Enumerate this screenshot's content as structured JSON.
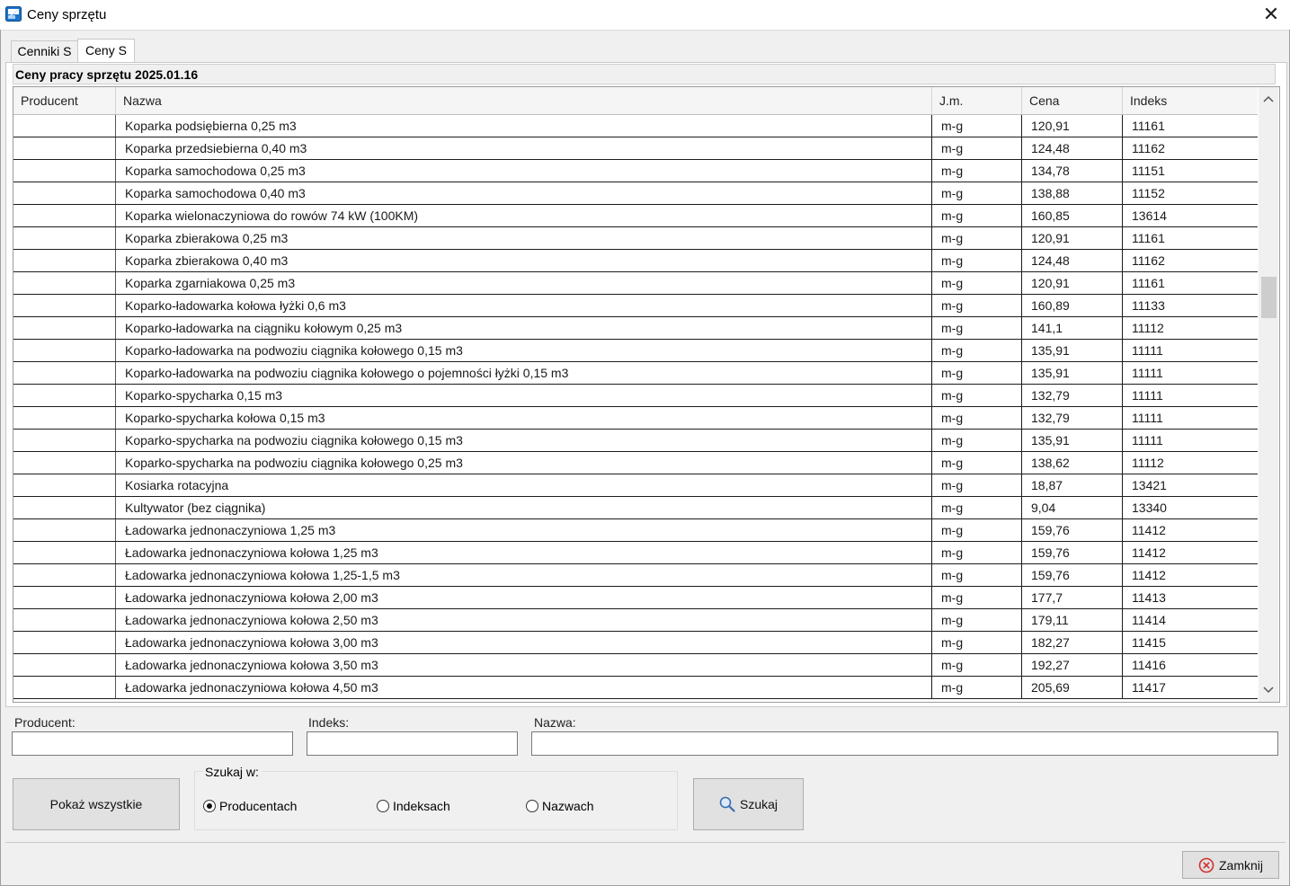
{
  "window": {
    "title": "Ceny sprzętu",
    "close_glyph": "✕"
  },
  "tabs": [
    {
      "label": "Cenniki S"
    },
    {
      "label": "Ceny S"
    }
  ],
  "caption": "Ceny pracy sprzętu 2025.01.16",
  "table": {
    "columns": [
      "Producent",
      "Nazwa",
      "J.m.",
      "Cena",
      "Indeks"
    ],
    "rows": [
      {
        "producent": "",
        "nazwa": "Koparka podsiębierna 0,25 m3",
        "jm": "m-g",
        "cena": "120,91",
        "indeks": "11161"
      },
      {
        "producent": "",
        "nazwa": "Koparka przedsiebierna 0,40 m3",
        "jm": "m-g",
        "cena": "124,48",
        "indeks": "11162"
      },
      {
        "producent": "",
        "nazwa": "Koparka samochodowa 0,25 m3",
        "jm": "m-g",
        "cena": "134,78",
        "indeks": "11151"
      },
      {
        "producent": "",
        "nazwa": "Koparka samochodowa 0,40 m3",
        "jm": "m-g",
        "cena": "138,88",
        "indeks": "11152"
      },
      {
        "producent": "",
        "nazwa": "Koparka wielonaczyniowa do rowów 74 kW (100KM)",
        "jm": "m-g",
        "cena": "160,85",
        "indeks": "13614"
      },
      {
        "producent": "",
        "nazwa": "Koparka zbierakowa 0,25 m3",
        "jm": "m-g",
        "cena": "120,91",
        "indeks": "11161"
      },
      {
        "producent": "",
        "nazwa": "Koparka zbierakowa 0,40 m3",
        "jm": "m-g",
        "cena": "124,48",
        "indeks": "11162"
      },
      {
        "producent": "",
        "nazwa": "Koparka zgarniakowa 0,25 m3",
        "jm": "m-g",
        "cena": "120,91",
        "indeks": "11161"
      },
      {
        "producent": "",
        "nazwa": "Koparko-ładowarka kołowa łyżki 0,6 m3",
        "jm": "m-g",
        "cena": "160,89",
        "indeks": "11133"
      },
      {
        "producent": "",
        "nazwa": "Koparko-ładowarka na ciągniku kołowym 0,25 m3",
        "jm": "m-g",
        "cena": "141,1",
        "indeks": "11112"
      },
      {
        "producent": "",
        "nazwa": "Koparko-ładowarka na podwoziu ciągnika kołowego 0,15 m3",
        "jm": "m-g",
        "cena": "135,91",
        "indeks": "11111"
      },
      {
        "producent": "",
        "nazwa": "Koparko-ładowarka na podwoziu ciągnika kołowego o pojemności łyżki 0,15 m3",
        "jm": "m-g",
        "cena": "135,91",
        "indeks": "11111"
      },
      {
        "producent": "",
        "nazwa": "Koparko-spycharka 0,15 m3",
        "jm": "m-g",
        "cena": "132,79",
        "indeks": "11111"
      },
      {
        "producent": "",
        "nazwa": "Koparko-spycharka kołowa 0,15 m3",
        "jm": "m-g",
        "cena": "132,79",
        "indeks": "11111"
      },
      {
        "producent": "",
        "nazwa": "Koparko-spycharka na podwoziu ciągnika kołowego 0,15 m3",
        "jm": "m-g",
        "cena": "135,91",
        "indeks": "11111"
      },
      {
        "producent": "",
        "nazwa": "Koparko-spycharka na podwoziu ciągnika kołowego 0,25 m3",
        "jm": "m-g",
        "cena": "138,62",
        "indeks": "11112"
      },
      {
        "producent": "",
        "nazwa": "Kosiarka rotacyjna",
        "jm": "m-g",
        "cena": "18,87",
        "indeks": "13421"
      },
      {
        "producent": "",
        "nazwa": "Kultywator (bez ciągnika)",
        "jm": "m-g",
        "cena": "9,04",
        "indeks": "13340"
      },
      {
        "producent": "",
        "nazwa": "Ładowarka jednonaczyniowa 1,25 m3",
        "jm": "m-g",
        "cena": "159,76",
        "indeks": "11412"
      },
      {
        "producent": "",
        "nazwa": "Ładowarka jednonaczyniowa kołowa 1,25 m3",
        "jm": "m-g",
        "cena": "159,76",
        "indeks": "11412"
      },
      {
        "producent": "",
        "nazwa": "Ładowarka jednonaczyniowa kołowa 1,25-1,5 m3",
        "jm": "m-g",
        "cena": "159,76",
        "indeks": "11412"
      },
      {
        "producent": "",
        "nazwa": "Ładowarka jednonaczyniowa kołowa 2,00 m3",
        "jm": "m-g",
        "cena": "177,7",
        "indeks": "11413"
      },
      {
        "producent": "",
        "nazwa": "Ładowarka jednonaczyniowa kołowa 2,50 m3",
        "jm": "m-g",
        "cena": "179,11",
        "indeks": "11414"
      },
      {
        "producent": "",
        "nazwa": "Ładowarka jednonaczyniowa kołowa 3,00 m3",
        "jm": "m-g",
        "cena": "182,27",
        "indeks": "11415"
      },
      {
        "producent": "",
        "nazwa": "Ładowarka jednonaczyniowa kołowa 3,50 m3",
        "jm": "m-g",
        "cena": "192,27",
        "indeks": "11416"
      },
      {
        "producent": "",
        "nazwa": "Ładowarka jednonaczyniowa kołowa 4,50 m3",
        "jm": "m-g",
        "cena": "205,69",
        "indeks": "11417"
      }
    ]
  },
  "filters": {
    "producent_label": "Producent:",
    "producent_value": "",
    "indeks_label": "Indeks:",
    "indeks_value": "",
    "nazwa_label": "Nazwa:",
    "nazwa_value": ""
  },
  "buttons": {
    "show_all": "Pokaż wszystkie",
    "search": "Szukaj",
    "close": "Zamknij"
  },
  "search_in": {
    "label": "Szukaj w:",
    "options": [
      {
        "label": "Producentach",
        "selected": true
      },
      {
        "label": "Indeksach",
        "selected": false
      },
      {
        "label": "Nazwach",
        "selected": false
      }
    ]
  },
  "icons": {
    "app": "app-window-icon",
    "search": "magnifier-icon",
    "close": "close-circle-icon"
  },
  "colors": {
    "close_icon": "#d32f2f"
  }
}
